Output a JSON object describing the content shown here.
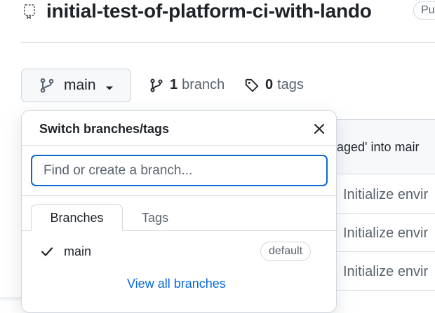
{
  "repo": {
    "name": "initial-test-of-platform-ci-with-lando",
    "visibility": "Pu"
  },
  "toolbar": {
    "current_branch": "main",
    "branches_count": "1",
    "branches_label": "branch",
    "tags_count": "0",
    "tags_label": "tags"
  },
  "background": {
    "header_text": "aged' into mair",
    "rows": [
      "Initialize envir",
      "Initialize envir",
      "Initialize envir"
    ]
  },
  "popover": {
    "title": "Switch branches/tags",
    "search_placeholder": "Find or create a branch...",
    "tabs": [
      {
        "label": "Branches",
        "active": true
      },
      {
        "label": "Tags",
        "active": false
      }
    ],
    "branches": [
      {
        "name": "main",
        "selected": true,
        "badge": "default"
      }
    ],
    "view_all_label": "View all branches"
  },
  "colors": {
    "accent": "#0969da",
    "border": "#d0d7de",
    "muted_text": "#59636e",
    "text": "#1f2328",
    "button_bg": "#f6f8fa"
  },
  "icons": {
    "repo": "repo-template-icon",
    "branch": "git-branch-icon",
    "tag": "tag-icon",
    "close": "close-icon",
    "check": "check-icon",
    "caret": "caret-down-icon"
  }
}
